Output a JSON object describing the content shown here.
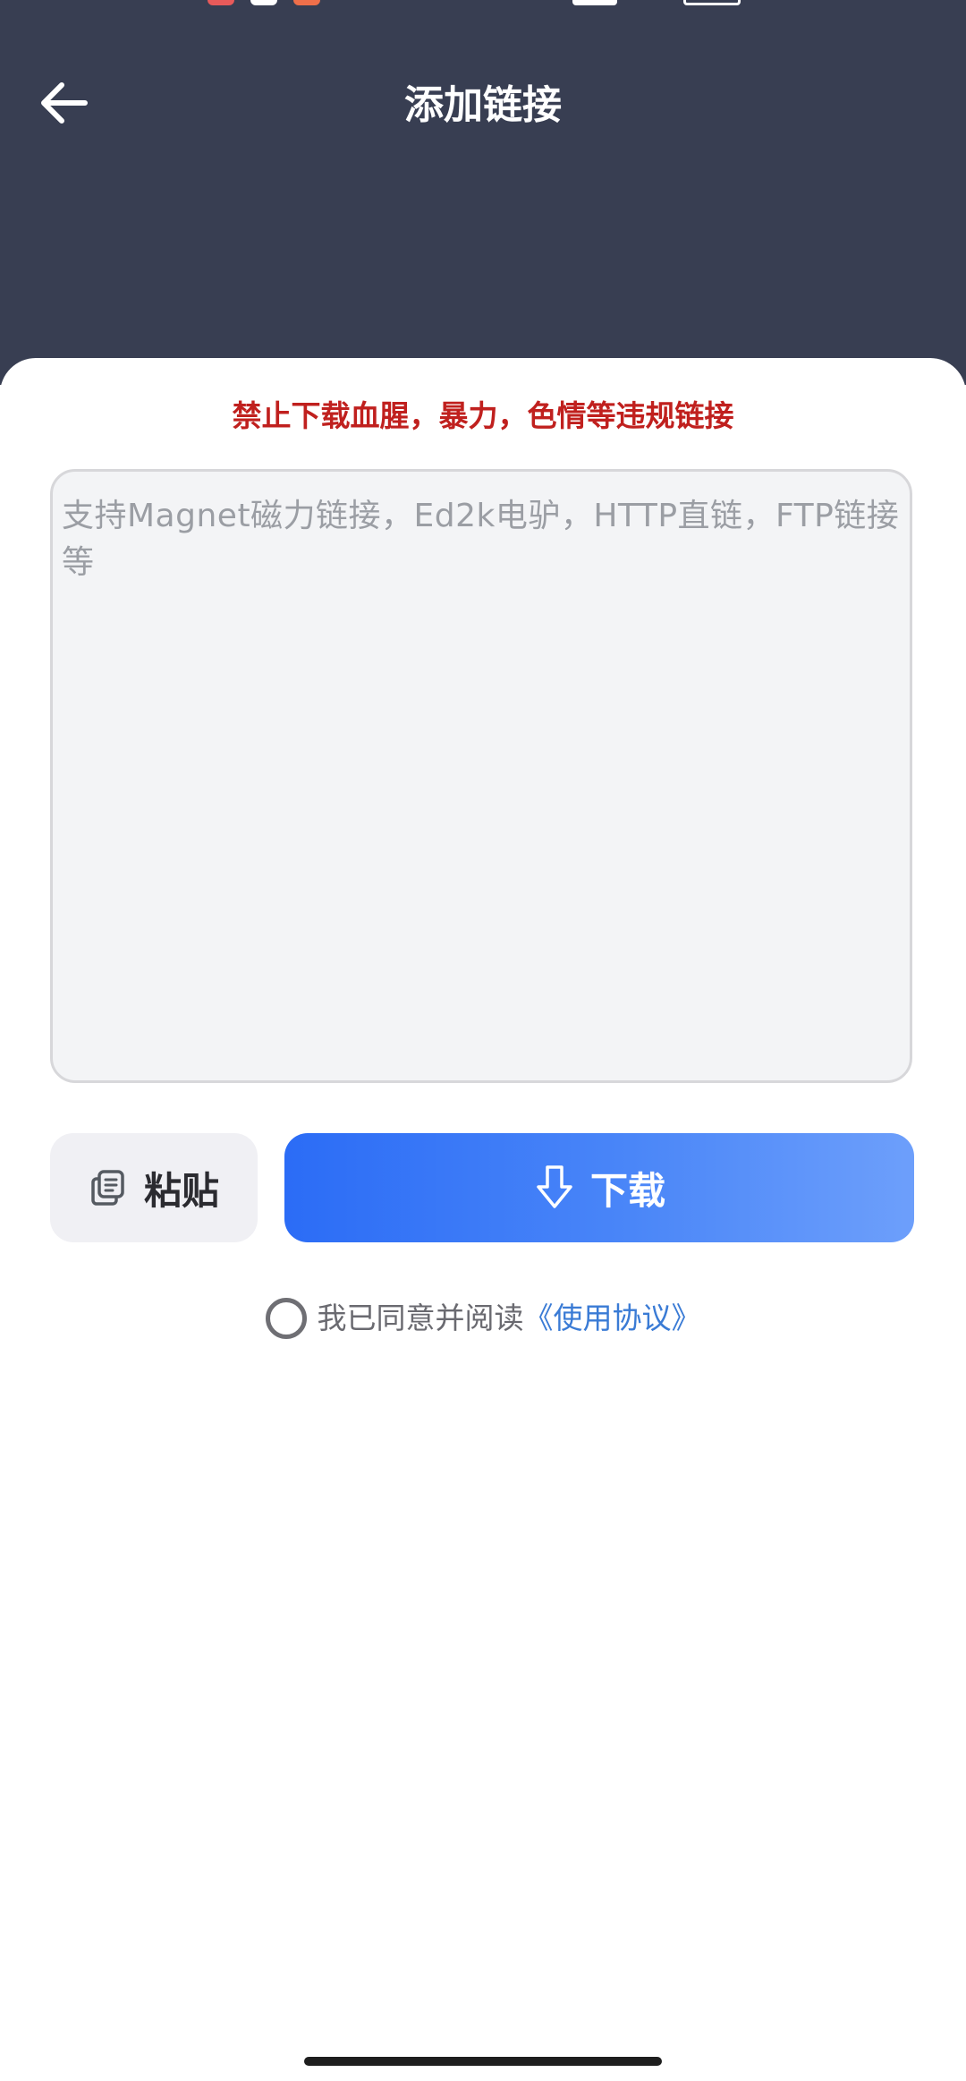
{
  "header": {
    "title": "添加链接",
    "back_icon": "arrow-left-icon"
  },
  "card": {
    "warning": "禁止下载血腥，暴力，色情等违规链接",
    "input": {
      "value": "",
      "placeholder": "支持Magnet磁力链接，Ed2k电驴，HTTP直链，FTP链接等"
    },
    "paste_button": {
      "label": "粘贴",
      "icon": "copy-icon"
    },
    "download_button": {
      "label": "下载",
      "icon": "arrow-down-icon"
    },
    "agreement": {
      "checked": false,
      "text": "我已同意并阅读",
      "link": "《使用协议》"
    }
  },
  "colors": {
    "header_bg": "#383e52",
    "warning": "#c0201e",
    "primary_start": "#2b6cf6",
    "primary_end": "#6d9ffb",
    "link": "#3a7bd5"
  }
}
